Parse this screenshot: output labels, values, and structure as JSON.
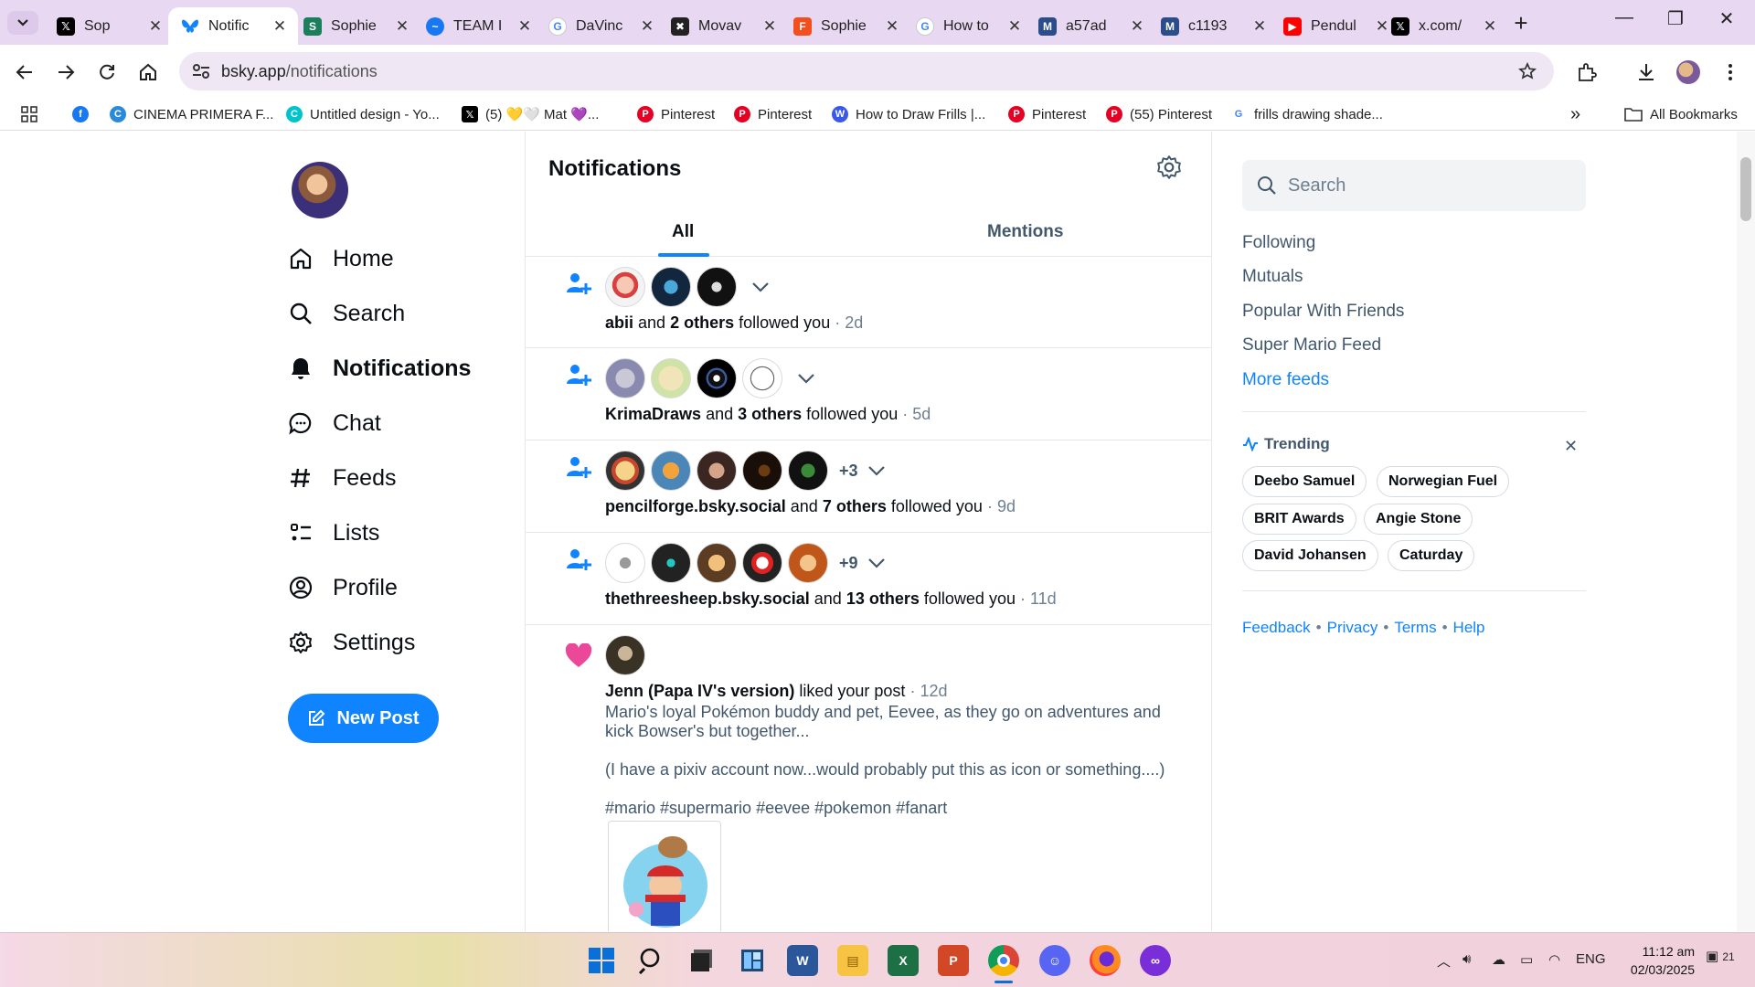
{
  "browser": {
    "tabs": [
      {
        "label": "Sop",
        "icon": "x-icon",
        "color": "#000000"
      },
      {
        "label": "Notific",
        "icon": "bluesky-icon",
        "color": "#1083fe",
        "active": true
      },
      {
        "label": "Sophie",
        "icon": "document-icon",
        "color": "#1a7f5a"
      },
      {
        "label": "TEAM I",
        "icon": "messenger-icon",
        "color": "#1877f2"
      },
      {
        "label": "DaVinc",
        "icon": "google-icon",
        "color": "#4285f4"
      },
      {
        "label": "Movav",
        "icon": "movavi-icon",
        "color": "#222222"
      },
      {
        "label": "Sophie",
        "icon": "figma-icon",
        "color": "#f24e1e"
      },
      {
        "label": "How to",
        "icon": "google-icon",
        "color": "#4285f4"
      },
      {
        "label": "a57ad",
        "icon": "mastodon-icon",
        "color": "#2b4d8c"
      },
      {
        "label": "c1193",
        "icon": "mastodon-icon",
        "color": "#2b4d8c"
      },
      {
        "label": "Pendul",
        "icon": "youtube-icon",
        "color": "#ff0000"
      },
      {
        "label": "x.com/",
        "icon": "x-icon",
        "color": "#000000"
      }
    ],
    "url_host": "bsky.app",
    "url_path": "/notifications",
    "bookmarks": [
      {
        "label": "",
        "icon": "facebook-icon",
        "color": "#1877f2"
      },
      {
        "label": "CINEMA PRIMERA F...",
        "icon": "globe-icon",
        "color": "#2b8ad8"
      },
      {
        "label": "Untitled design - Yo...",
        "icon": "canva-icon",
        "color": "#00c4cc"
      },
      {
        "label": "(5) 💛🤍 Mat 💜...",
        "icon": "x-icon",
        "color": "#000000"
      },
      {
        "label": "Pinterest",
        "icon": "pinterest-icon",
        "color": "#e60023"
      },
      {
        "label": "Pinterest",
        "icon": "pinterest-icon",
        "color": "#e60023"
      },
      {
        "label": "How to Draw Frills |...",
        "icon": "wordpress-icon",
        "color": "#3858e9"
      },
      {
        "label": "Pinterest",
        "icon": "pinterest-icon",
        "color": "#e60023"
      },
      {
        "label": "(55) Pinterest",
        "icon": "pinterest-icon",
        "color": "#e60023"
      },
      {
        "label": "frills drawing shade...",
        "icon": "google-icon",
        "color": "#4285f4"
      }
    ],
    "all_bookmarks": "All Bookmarks"
  },
  "nav": {
    "items": [
      {
        "label": "Home",
        "icon": "home-icon"
      },
      {
        "label": "Search",
        "icon": "search-icon"
      },
      {
        "label": "Notifications",
        "icon": "bell-icon",
        "active": true
      },
      {
        "label": "Chat",
        "icon": "chat-icon"
      },
      {
        "label": "Feeds",
        "icon": "hashtag-icon"
      },
      {
        "label": "Lists",
        "icon": "list-icon"
      },
      {
        "label": "Profile",
        "icon": "profile-icon"
      },
      {
        "label": "Settings",
        "icon": "gear-icon"
      }
    ],
    "new_post": "New Post"
  },
  "main": {
    "title": "Notifications",
    "tabs": [
      "All",
      "Mentions"
    ],
    "notifications": [
      {
        "kind": "follow",
        "who": "abii",
        "and": "and",
        "others": "2 others",
        "action": "followed you",
        "ago": "· 2d",
        "more": ""
      },
      {
        "kind": "follow",
        "who": "KrimaDraws",
        "and": "and",
        "others": "3 others",
        "action": "followed you",
        "ago": "· 5d",
        "more": ""
      },
      {
        "kind": "follow",
        "who": "pencilforge.bsky.social",
        "and": "and",
        "others": "7 others",
        "action": "followed you",
        "ago": "· 9d",
        "more": "+3"
      },
      {
        "kind": "follow",
        "who": "thethreesheep.bsky.social",
        "and": "and",
        "others": "13 others",
        "action": "followed you",
        "ago": "· 11d",
        "more": "+9"
      },
      {
        "kind": "like",
        "who": "Jenn (Papa IV's version)",
        "action": "liked your post",
        "ago": "· 12d",
        "post": {
          "p1": "Mario's loyal Pokémon buddy and pet, Eevee, as they go on adventures and kick Bowser's but together...",
          "p2": "(I have a pixiv account now...would probably put this as icon or something....)",
          "p3": "#mario #supermario #eevee #pokemon #fanart"
        }
      }
    ]
  },
  "right": {
    "search_placeholder": "Search",
    "feeds": [
      "Following",
      "Mutuals",
      "Popular With Friends",
      "Super Mario Feed"
    ],
    "more_feeds": "More feeds",
    "trending_title": "Trending",
    "trending": [
      "Deebo Samuel",
      "Norwegian Fuel",
      "BRIT Awards",
      "Angie Stone",
      "David Johansen",
      "Caturday"
    ],
    "footer": [
      "Feedback",
      "Privacy",
      "Terms",
      "Help"
    ]
  },
  "taskbar": {
    "language": "ENG",
    "time": "11:12 am",
    "date": "02/03/2025",
    "notification_count": "21"
  },
  "colors": {
    "accent": "#1083fe",
    "like": "#ec4899",
    "tabbar": "#e8d8f2"
  }
}
